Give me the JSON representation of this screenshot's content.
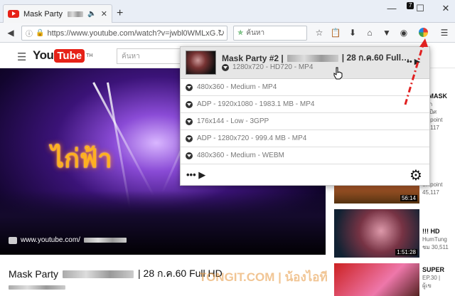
{
  "browser": {
    "tab_title": "Mask Party #2 |",
    "new_tab": "+",
    "url": "https://www.youtube.com/watch?v=jwbl0WMLxG…",
    "search_placeholder": "ค้นหา",
    "badge_count": "7",
    "window_controls": {
      "minimize": "—",
      "maximize": "☐",
      "close": "✕"
    }
  },
  "youtube": {
    "logo_you": "You",
    "logo_tube": "Tube",
    "logo_region": "TH",
    "search_placeholder": "ค้นหา",
    "video_overlay_text": "ไก่ฟ้า",
    "watermark_site": "www.youtube.com/",
    "video_title_prefix": "Mask Party",
    "video_title_suffix": "| 28 ก.ค.60 Full HD",
    "sidebar": [
      {
        "title": "E MASK",
        "meta": "กาก",
        "meta2": "อบปีศ",
        "meta3": "orkpoint",
        "meta4": "24,117",
        "duration": ""
      },
      {
        "title": "",
        "meta": "orkpoint",
        "meta2": "45,117",
        "meta3": "",
        "meta4": "",
        "duration": "56:14"
      },
      {
        "title": "!!! HD",
        "meta": "HumTung",
        "meta2": "ชม 30,511",
        "meta3": "",
        "meta4": "",
        "duration": "1:51:28"
      },
      {
        "title": "SUPER",
        "meta": "EP.30 |",
        "meta2": "ผู้เข",
        "meta3": "",
        "meta4": "",
        "duration": ""
      }
    ]
  },
  "downloader": {
    "title_prefix": "Mask Party #2 |",
    "title_suffix": "| 28 ก.ค.60 Full…",
    "main_option": "1280x720 - HD720 - MP4",
    "options": [
      "480x360 - Medium - MP4",
      "ADP - 1920x1080 - 1983.1 MB - MP4",
      "176x144 - Low - 3GPP",
      "ADP - 1280x720 - 999.4 MB - MP4",
      "480x360 - Medium - WEBM"
    ],
    "more_label": "••• ▶",
    "head_more_label": "•• ▶"
  },
  "page_watermark": "TONGIT.COM | น้องไอที"
}
